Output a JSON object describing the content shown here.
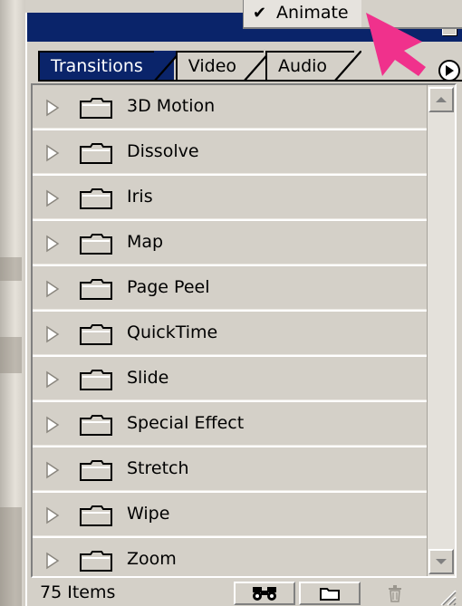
{
  "popup_menu": {
    "check_mark": "✔",
    "item_label": "Animate"
  },
  "tabs": [
    {
      "label": "Transitions",
      "active": true
    },
    {
      "label": "Video",
      "active": false
    },
    {
      "label": "Audio",
      "active": false
    }
  ],
  "transitions": [
    {
      "label": "3D Motion"
    },
    {
      "label": "Dissolve"
    },
    {
      "label": "Iris"
    },
    {
      "label": "Map"
    },
    {
      "label": "Page Peel"
    },
    {
      "label": "QuickTime"
    },
    {
      "label": "Slide"
    },
    {
      "label": "Special Effect"
    },
    {
      "label": "Stretch"
    },
    {
      "label": "Wipe"
    },
    {
      "label": "Zoom"
    }
  ],
  "footer": {
    "item_count": "75 Items"
  },
  "icons": {
    "expand": "triangle-right-icon",
    "folder": "folder-icon",
    "find": "binoculars-icon",
    "new_bin": "new-folder-icon",
    "delete": "trash-icon",
    "panel_menu": "panel-menu-arrow-icon",
    "pointer": "pink-cursor-arrow-icon"
  },
  "colors": {
    "title_bar": "#0a246a",
    "panel_bg": "#d4d0c8",
    "cursor": "#f0318c"
  }
}
